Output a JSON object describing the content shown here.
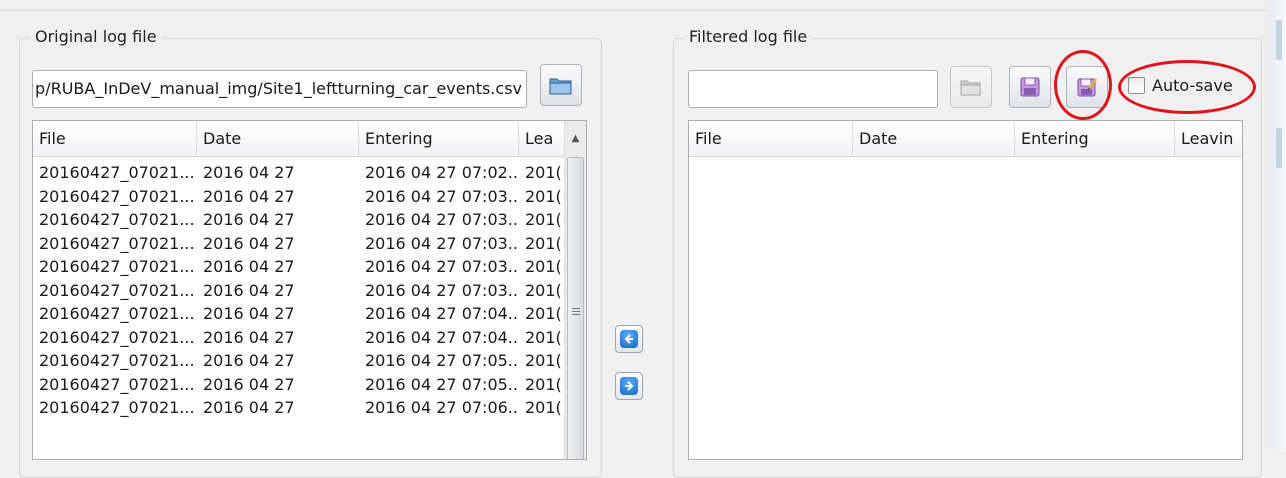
{
  "original": {
    "group_title": "Original log file",
    "path_value": "p/RUBA_InDeV_manual_img/Site1_leftturning_car_events.csv",
    "open_icon": "folder-open-icon",
    "columns": [
      "File",
      "Date",
      "Entering",
      "Lea"
    ],
    "rows": [
      [
        "20160427_07021...",
        "2016 04 27",
        "2016 04 27 07:02...",
        "201("
      ],
      [
        "20160427_07021...",
        "2016 04 27",
        "2016 04 27 07:03...",
        "201("
      ],
      [
        "20160427_07021...",
        "2016 04 27",
        "2016 04 27 07:03...",
        "201("
      ],
      [
        "20160427_07021...",
        "2016 04 27",
        "2016 04 27 07:03...",
        "201("
      ],
      [
        "20160427_07021...",
        "2016 04 27",
        "2016 04 27 07:03...",
        "201("
      ],
      [
        "20160427_07021...",
        "2016 04 27",
        "2016 04 27 07:03...",
        "201("
      ],
      [
        "20160427_07021...",
        "2016 04 27",
        "2016 04 27 07:04...",
        "201("
      ],
      [
        "20160427_07021...",
        "2016 04 27",
        "2016 04 27 07:04...",
        "201("
      ],
      [
        "20160427_07021...",
        "2016 04 27",
        "2016 04 27 07:05...",
        "201("
      ],
      [
        "20160427_07021...",
        "2016 04 27",
        "2016 04 27 07:05...",
        "201("
      ],
      [
        "20160427_07021...",
        "2016 04 27",
        "2016 04 27 07:06...",
        "201("
      ]
    ]
  },
  "filtered": {
    "group_title": "Filtered log file",
    "path_value": "",
    "autosave_label": "Auto-save",
    "autosave_checked": false,
    "columns": [
      "File",
      "Date",
      "Entering",
      "Leavin"
    ]
  },
  "icons": {
    "move_left": "arrow-left-icon",
    "move_right": "arrow-right-icon",
    "save": "save-icon",
    "save_as": "save-as-icon"
  },
  "colors": {
    "annotation": "#e0141b",
    "arrow_blue": "#1565c8",
    "save_purple": "#b07ad6"
  }
}
